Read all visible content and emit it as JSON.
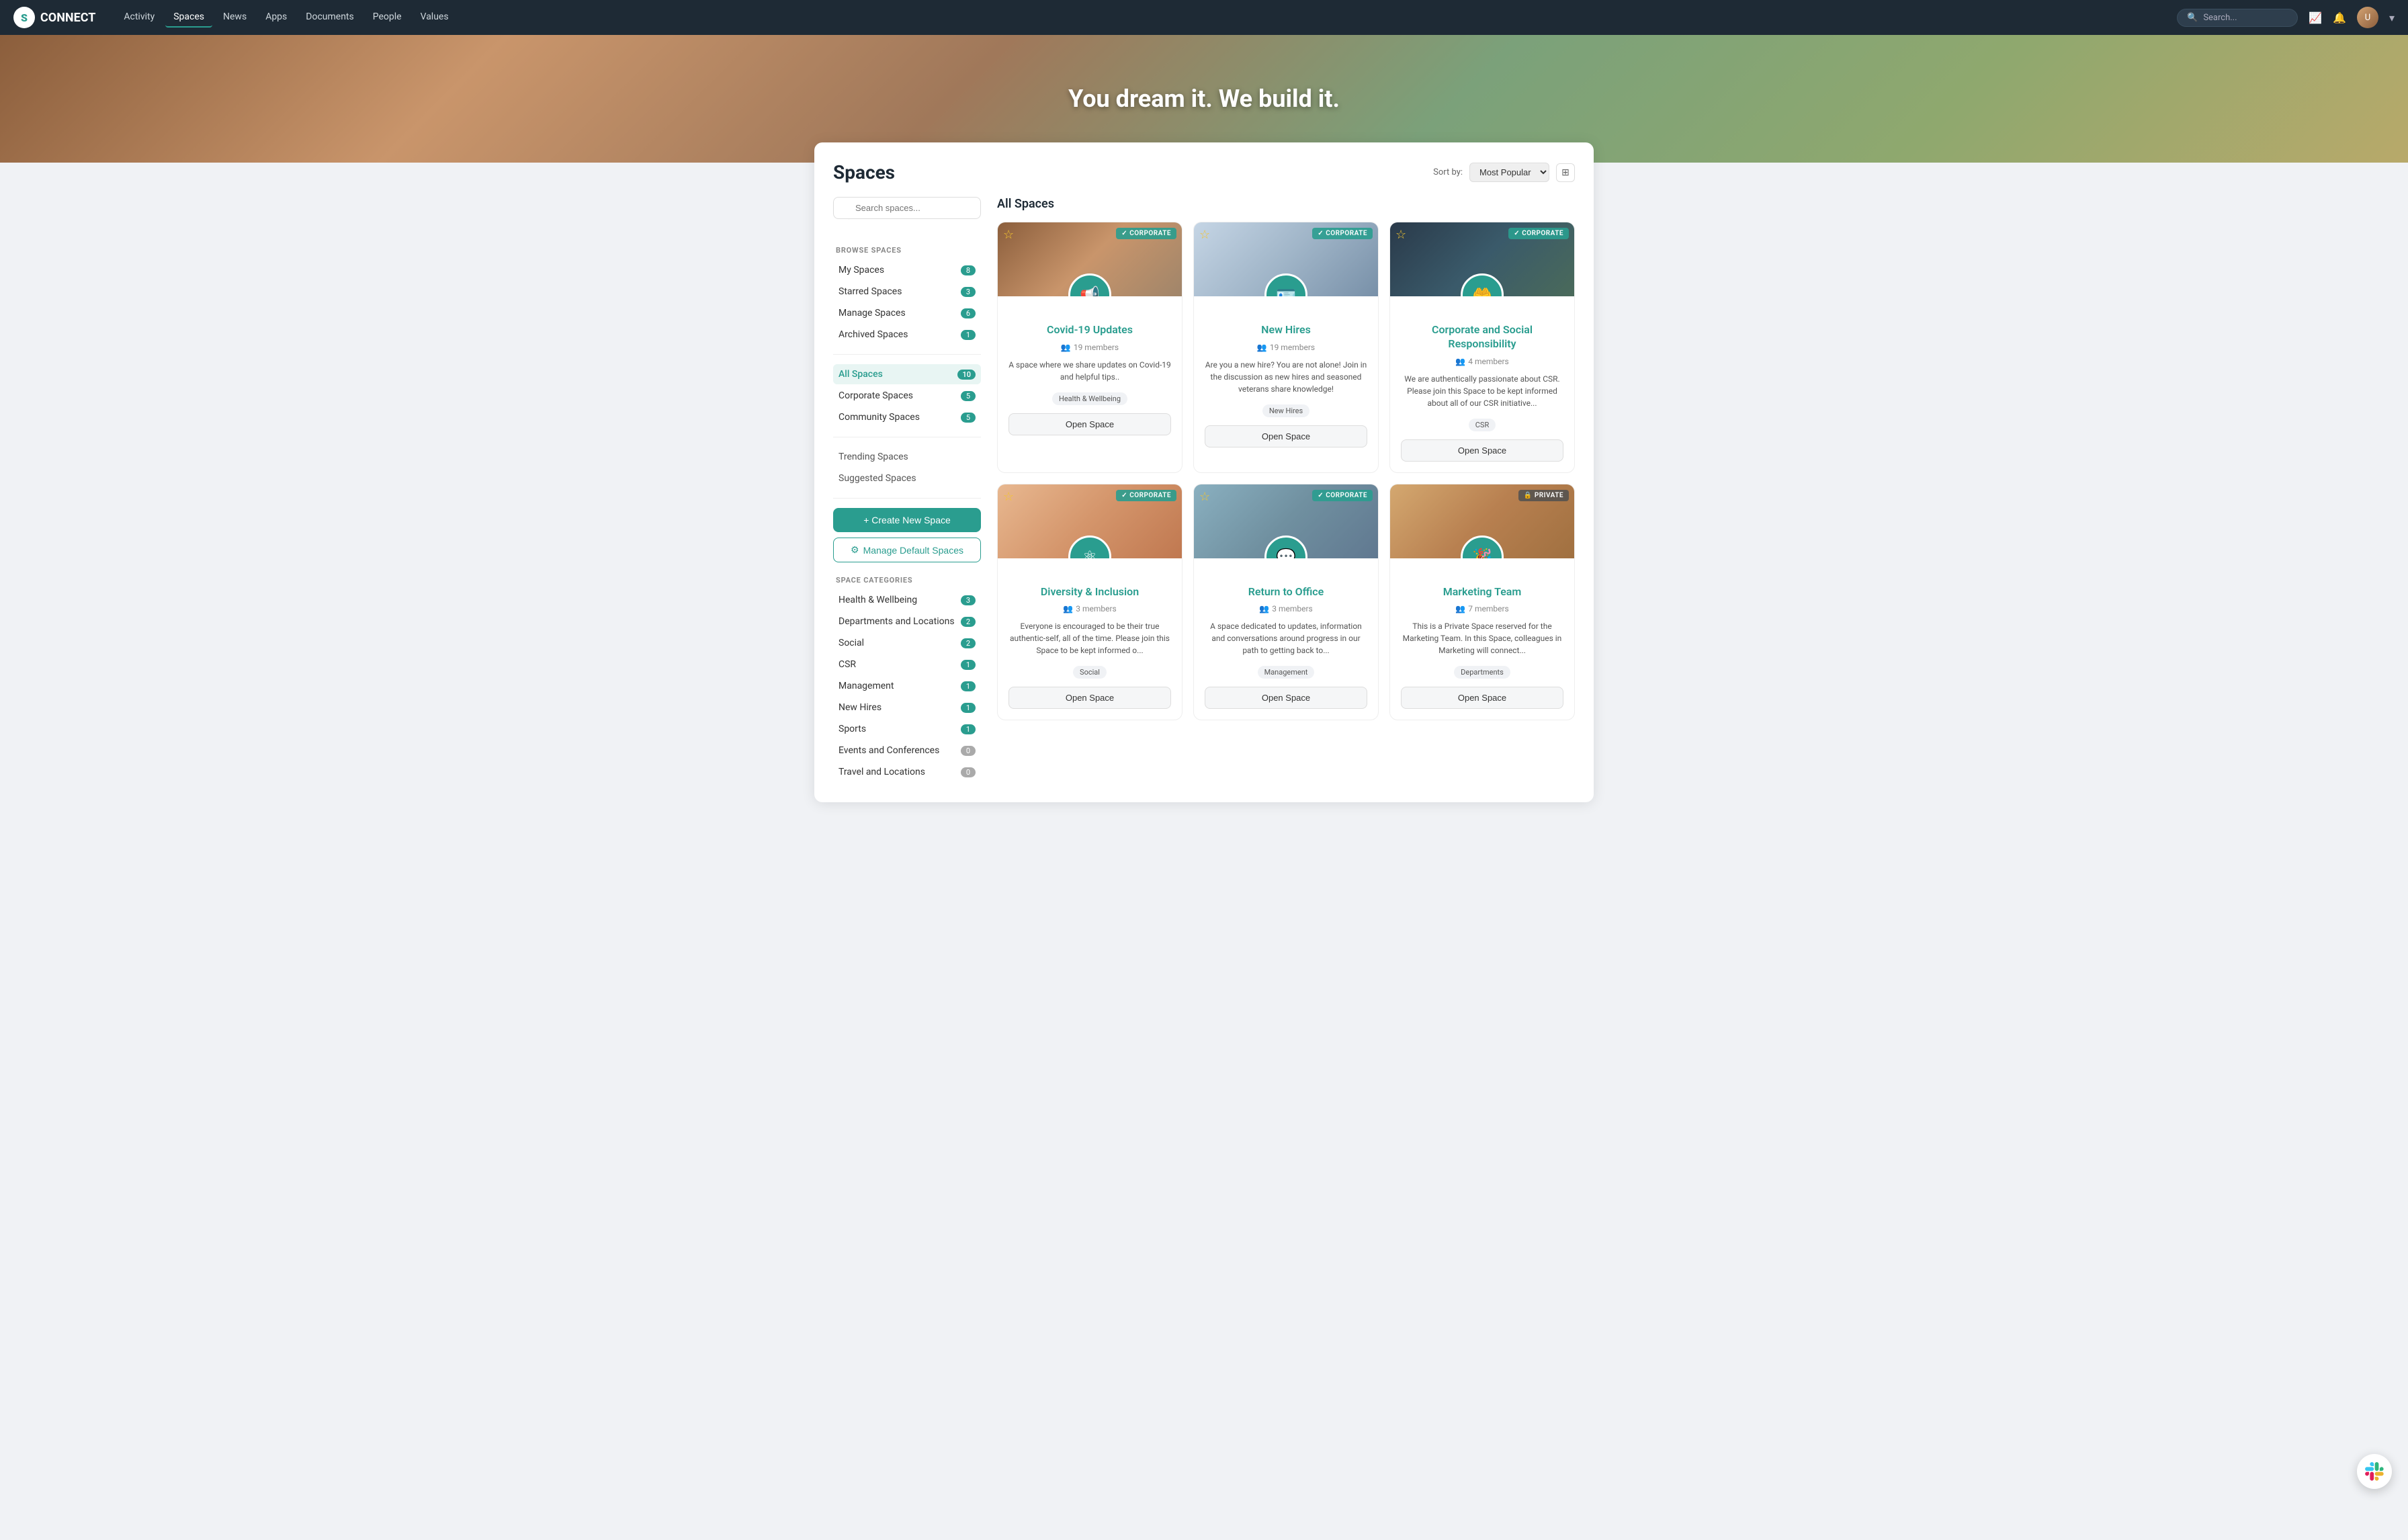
{
  "app": {
    "name": "CONNECT",
    "logo_letter": "S"
  },
  "nav": {
    "links": [
      {
        "label": "Activity",
        "active": false
      },
      {
        "label": "Spaces",
        "active": true
      },
      {
        "label": "News",
        "active": false
      },
      {
        "label": "Apps",
        "active": false
      },
      {
        "label": "Documents",
        "active": false
      },
      {
        "label": "People",
        "active": false
      },
      {
        "label": "Values",
        "active": false
      }
    ],
    "search_placeholder": "Search...",
    "sort_label": "Sort by:",
    "sort_option": "Most Popular"
  },
  "hero": {
    "text_plain": "You dream it.",
    "text_bold": "We build it."
  },
  "page": {
    "title": "Spaces",
    "section_title": "All Spaces"
  },
  "sidebar": {
    "search_placeholder": "Search spaces...",
    "browse_title": "BROWSE SPACES",
    "browse_items": [
      {
        "label": "My Spaces",
        "count": "8"
      },
      {
        "label": "Starred Spaces",
        "count": "3"
      },
      {
        "label": "Manage Spaces",
        "count": "6"
      },
      {
        "label": "Archived Spaces",
        "count": "1"
      }
    ],
    "filter_items": [
      {
        "label": "All Spaces",
        "count": "10",
        "active": true
      },
      {
        "label": "Corporate Spaces",
        "count": "5",
        "active": false
      },
      {
        "label": "Community Spaces",
        "count": "5",
        "active": false
      }
    ],
    "plain_items": [
      {
        "label": "Trending Spaces"
      },
      {
        "label": "Suggested Spaces"
      }
    ],
    "create_label": "+ Create New Space",
    "manage_label": "Manage Default Spaces",
    "categories_title": "SPACE CATEGORIES",
    "categories": [
      {
        "label": "Health & Wellbeing",
        "count": "3"
      },
      {
        "label": "Departments and Locations",
        "count": "2"
      },
      {
        "label": "Social",
        "count": "2"
      },
      {
        "label": "CSR",
        "count": "1"
      },
      {
        "label": "Management",
        "count": "1"
      },
      {
        "label": "New Hires",
        "count": "1"
      },
      {
        "label": "Sports",
        "count": "1"
      },
      {
        "label": "Events and Conferences",
        "count": "0"
      },
      {
        "label": "Travel and Locations",
        "count": "0"
      }
    ]
  },
  "spaces": [
    {
      "name": "Covid-19 Updates",
      "members": "19 members",
      "description": "A space where we share updates on Covid-19 and helpful tips..",
      "tag": "Health & Wellbeing",
      "badge": "CORPORATE",
      "badge_type": "corporate",
      "starred": true,
      "icon": "📢",
      "img_class": "img-covid",
      "open_label": "Open Space"
    },
    {
      "name": "New Hires",
      "members": "19 members",
      "description": "Are you a new hire? You are not alone! Join in the discussion as new hires and seasoned veterans share knowledge!",
      "tag": "New Hires",
      "badge": "CORPORATE",
      "badge_type": "corporate",
      "starred": true,
      "icon": "🪪",
      "img_class": "img-newhires",
      "open_label": "Open Space"
    },
    {
      "name": "Corporate and Social Responsibility",
      "members": "4 members",
      "description": "We are authentically passionate about CSR. Please join this Space to be kept informed about all of our CSR initiative...",
      "tag": "CSR",
      "badge": "CORPORATE",
      "badge_type": "corporate",
      "starred": true,
      "icon": "🤲",
      "img_class": "img-csr",
      "open_label": "Open Space"
    },
    {
      "name": "Diversity & Inclusion",
      "members": "3 members",
      "description": "Everyone is encouraged to be their true authentic-self, all of the time. Please join this Space to be kept informed o...",
      "tag": "Social",
      "badge": "CORPORATE",
      "badge_type": "corporate",
      "starred": true,
      "icon": "⚛",
      "img_class": "img-diversity",
      "open_label": "Open Space"
    },
    {
      "name": "Return to Office",
      "members": "3 members",
      "description": "A space dedicated to updates, information and conversations around progress in our path to getting back to...",
      "tag": "Management",
      "badge": "CORPORATE",
      "badge_type": "corporate",
      "starred": true,
      "icon": "💬",
      "img_class": "img-rto",
      "open_label": "Open Space"
    },
    {
      "name": "Marketing Team",
      "members": "7 members",
      "description": "This is a Private Space reserved for the Marketing Team. In this Space, colleagues in Marketing will connect...",
      "tag": "Departments",
      "badge": "PRIVATE",
      "badge_type": "private",
      "starred": false,
      "icon": "🎉",
      "img_class": "img-marketing",
      "open_label": "Open Space"
    }
  ]
}
